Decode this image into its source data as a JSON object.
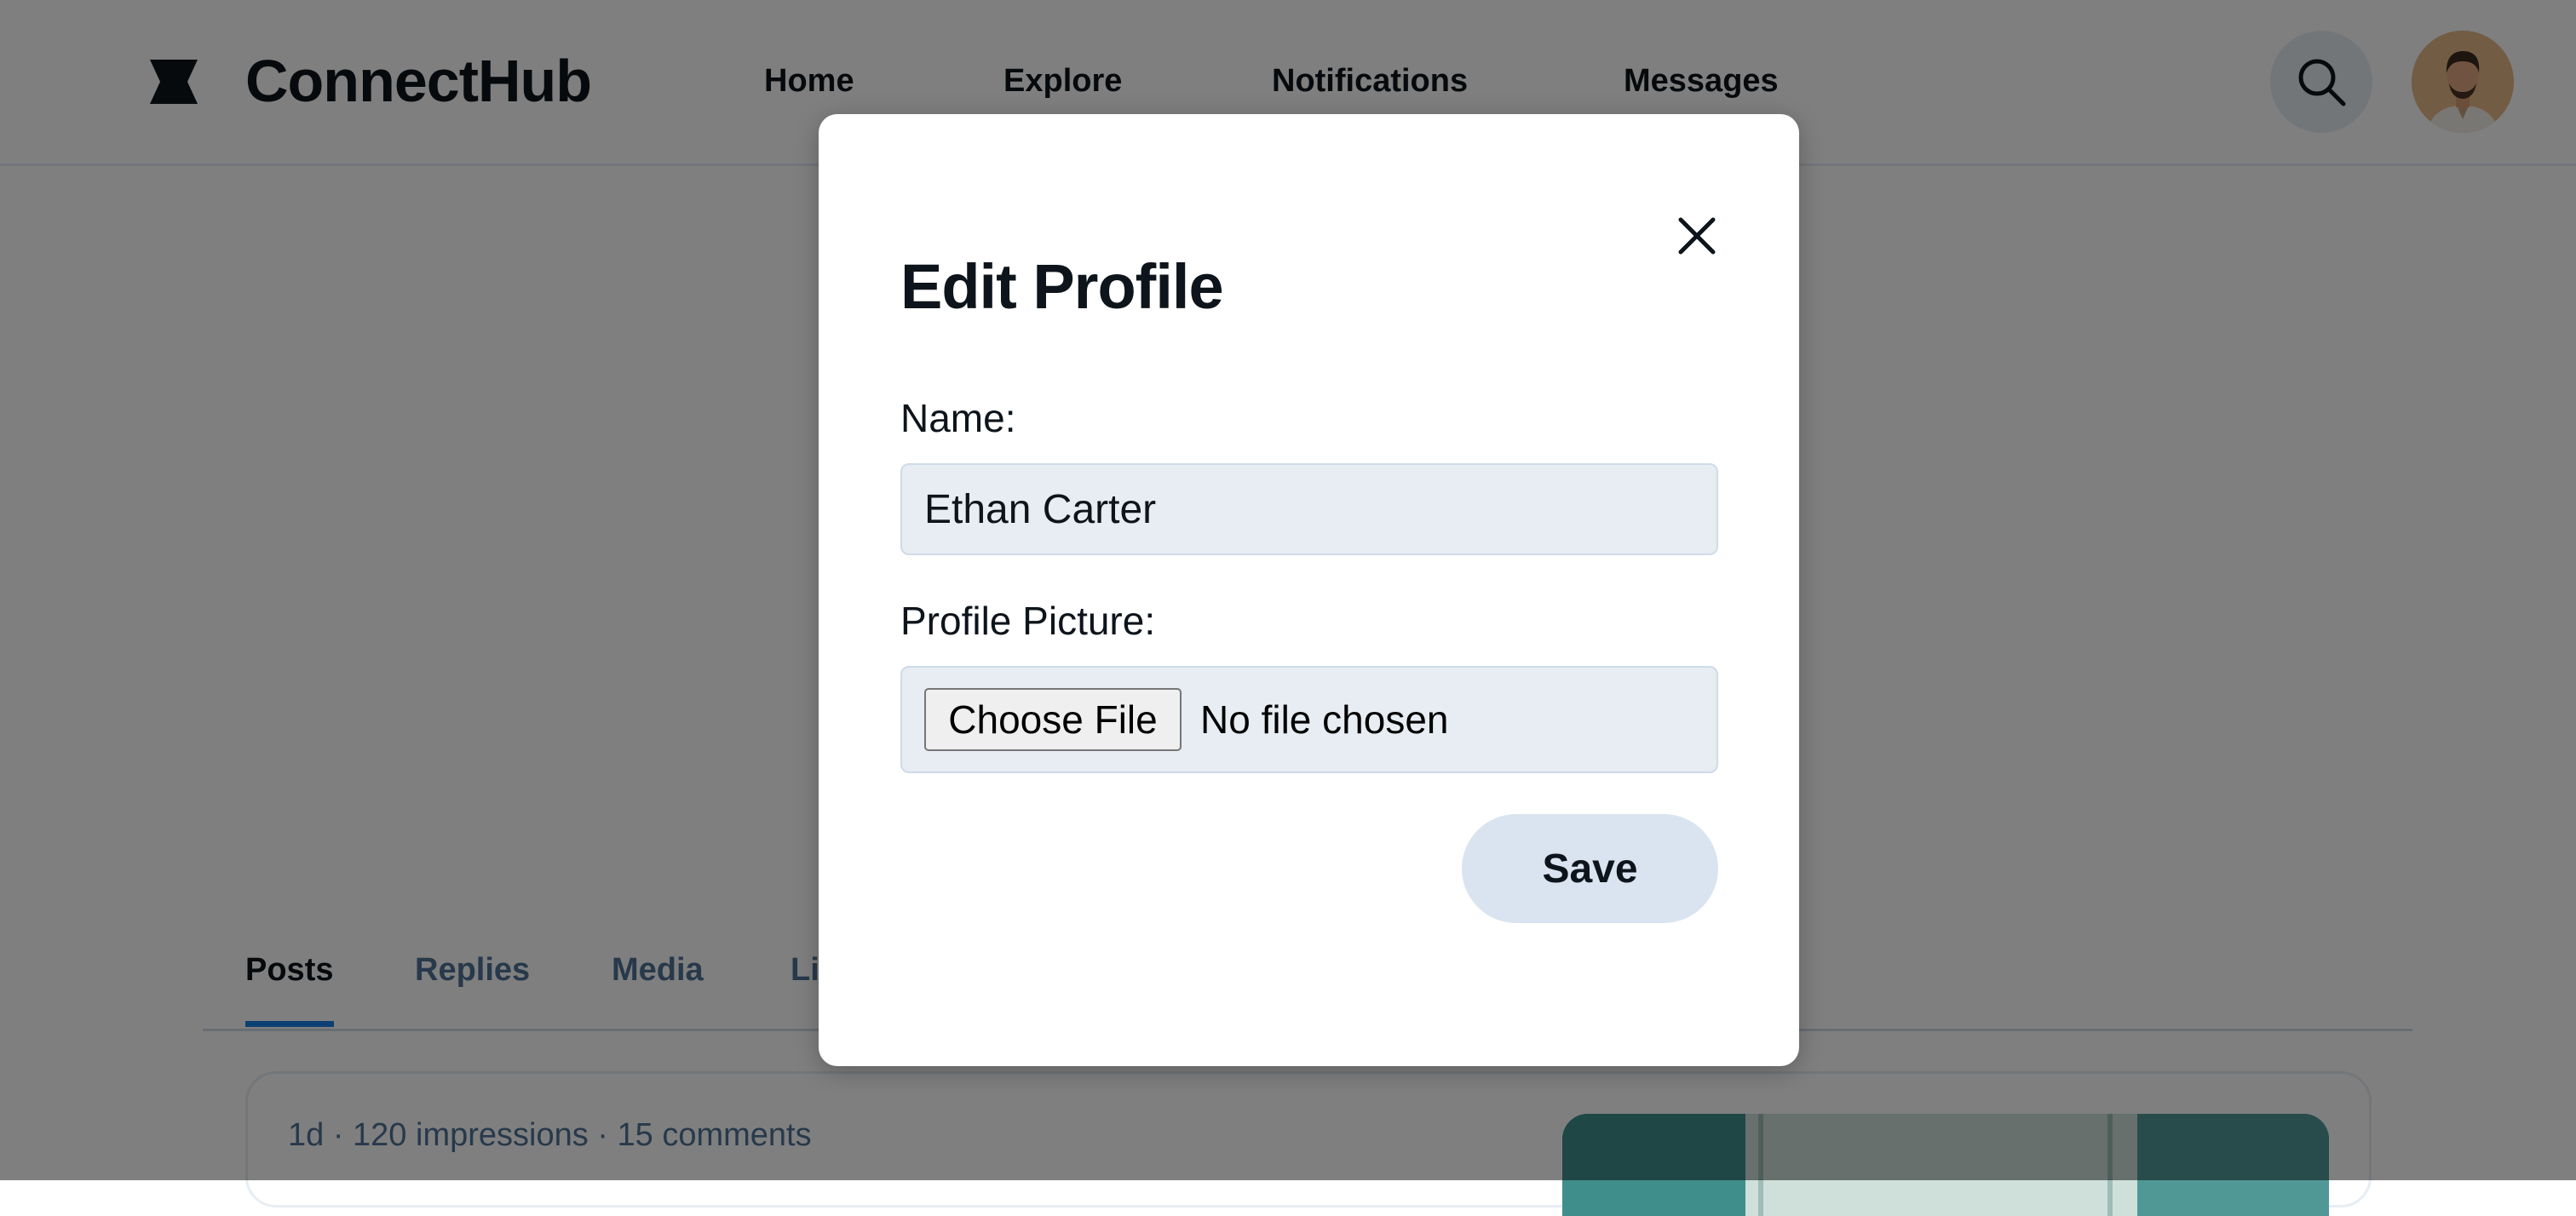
{
  "app": {
    "brand": "ConnectHub",
    "nav": [
      {
        "label": "Home"
      },
      {
        "label": "Explore"
      },
      {
        "label": "Notifications"
      },
      {
        "label": "Messages"
      }
    ],
    "icons": {
      "logo": "connecthub-logo-icon",
      "search": "search-icon",
      "avatar": "user-avatar"
    }
  },
  "profile": {
    "tabs": [
      {
        "label": "Posts",
        "active": true
      },
      {
        "label": "Replies",
        "active": false
      },
      {
        "label": "Media",
        "active": false
      },
      {
        "label": "Li",
        "active": false
      }
    ],
    "post": {
      "meta": "1d · 120 impressions · 15 comments"
    }
  },
  "modal": {
    "title": "Edit Profile",
    "close_icon": "close-icon",
    "name_label": "Name:",
    "name_value": "Ethan Carter",
    "picture_label": "Profile Picture:",
    "choose_file_label": "Choose File",
    "file_status": "No file chosen",
    "save_label": "Save"
  },
  "colors": {
    "text_primary": "#0e141b",
    "text_secondary": "#4e7397",
    "accent": "#1980e6",
    "input_bg": "#e7edf3",
    "save_bg": "#d9e4f0",
    "overlay": "rgba(0,0,0,0.5)"
  }
}
